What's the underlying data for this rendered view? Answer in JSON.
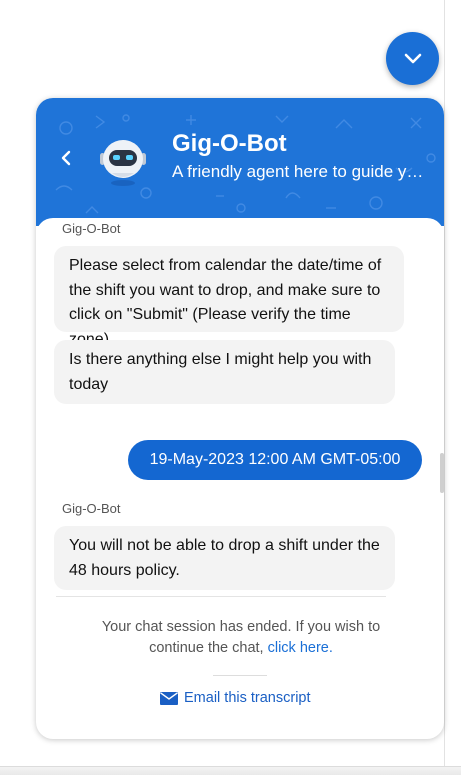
{
  "header": {
    "bot_name": "Gig-O-Bot",
    "subtitle": "A friendly agent here to guide you...",
    "back_icon": "chevron-left-icon",
    "minimize_icon": "chevron-down-icon"
  },
  "messages": [
    {
      "role": "bot",
      "sender": "Gig-O-Bot",
      "text": "Please select from calendar the date/time of the shift you want to drop, and make sure to click on \"Submit\" (Please verify the time zone)"
    },
    {
      "role": "bot",
      "text": "Is there anything else I might help you with today"
    },
    {
      "role": "user",
      "text": "19-May-2023 12:00 AM GMT-05:00"
    },
    {
      "role": "bot",
      "sender": "Gig-O-Bot",
      "text": "You will not be able to drop a shift under the 48 hours policy."
    }
  ],
  "footer": {
    "ended_text": "Your chat session has ended. If you wish to continue the chat,",
    "click_here": "click here.",
    "email_label": "Email this transcript",
    "email_icon": "envelope-icon"
  },
  "colors": {
    "brand": "#1f74d8",
    "user_bubble": "#1467d1",
    "bot_bubble": "#f3f3f3"
  }
}
